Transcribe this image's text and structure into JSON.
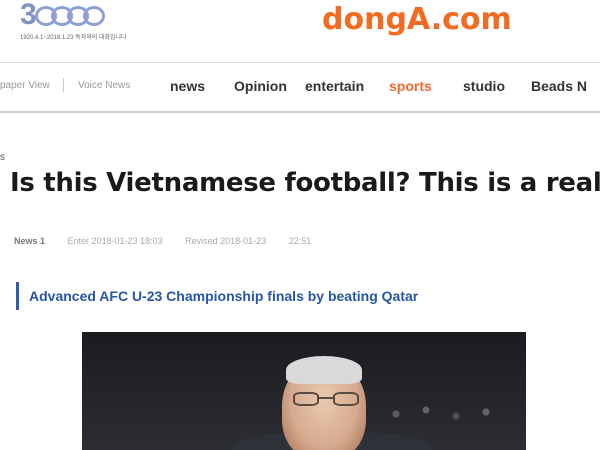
{
  "header": {
    "anniversary_number": "3",
    "anniversary_tagline": "1920.4.1~2018.1.23 독자와의 대화입니다",
    "logo_text": "dongA.com",
    "logo_color": "#f36b21"
  },
  "nav": {
    "left_links": [
      "paper View",
      "Voice News"
    ],
    "items": [
      {
        "label": "news",
        "active": false
      },
      {
        "label": "Opinion",
        "active": false
      },
      {
        "label": "entertain",
        "active": false
      },
      {
        "label": "sports",
        "active": true
      },
      {
        "label": "studio",
        "active": false
      },
      {
        "label": "Beads N",
        "active": false
      }
    ],
    "active_color": "#ef6a2d"
  },
  "article": {
    "section_marker": "s",
    "headline": "Is this Vietnamese football? This is a real",
    "meta": {
      "author": "News 1",
      "entered": "Enter 2018-01-23 18:03",
      "revised": "Revised 2018-01-23",
      "time": "22:51"
    },
    "subheadline": "Advanced AFC U-23 Championship finals by beating Qatar",
    "subheadline_color": "#2756a6"
  }
}
